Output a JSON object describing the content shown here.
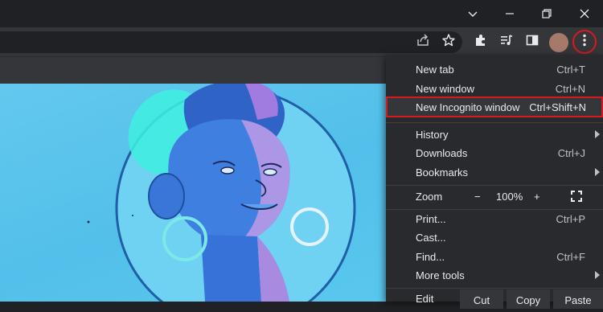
{
  "window_controls": {
    "dropdown_icon": "chevron-down-icon",
    "minimize_icon": "minimize-icon",
    "restore_icon": "restore-icon",
    "close_icon": "close-icon"
  },
  "toolbar": {
    "share_icon": "share-icon",
    "bookmark_icon": "star-icon",
    "extensions_icon": "puzzle-icon",
    "media_icon": "media-control-icon",
    "side_panel_icon": "side-panel-icon",
    "kebab_icon": "more-vertical-icon"
  },
  "menu": {
    "items": [
      {
        "label": "New tab",
        "shortcut": "Ctrl+T"
      },
      {
        "label": "New window",
        "shortcut": "Ctrl+N"
      },
      {
        "label": "New Incognito window",
        "shortcut": "Ctrl+Shift+N"
      },
      {
        "label": "History",
        "shortcut": ""
      },
      {
        "label": "Downloads",
        "shortcut": "Ctrl+J"
      },
      {
        "label": "Bookmarks",
        "shortcut": ""
      },
      {
        "label": "Print...",
        "shortcut": "Ctrl+P"
      },
      {
        "label": "Cast...",
        "shortcut": ""
      },
      {
        "label": "Find...",
        "shortcut": "Ctrl+F"
      },
      {
        "label": "More tools",
        "shortcut": ""
      }
    ],
    "zoom": {
      "label": "Zoom",
      "minus": "−",
      "value": "100%",
      "plus": "+",
      "fullscreen_icon": "fullscreen-icon"
    },
    "edit": {
      "label": "Edit",
      "cut": "Cut",
      "copy": "Copy",
      "paste": "Paste"
    }
  },
  "colors": {
    "highlight_border": "#d71920",
    "menu_bg": "#292a2d",
    "toolbar_bg": "#35363a"
  }
}
